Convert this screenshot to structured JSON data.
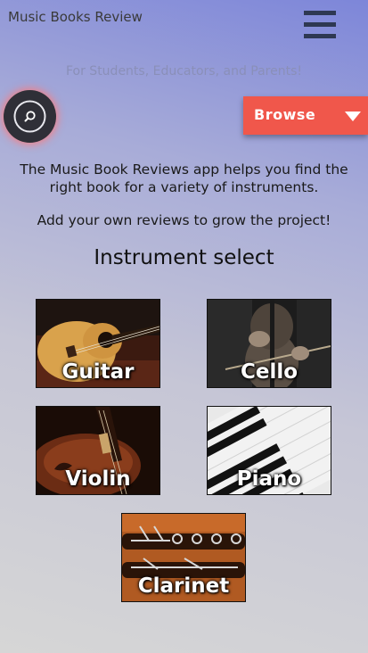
{
  "header": {
    "title": "Music Books Review",
    "tagline": "For Students, Educators, and Parents!"
  },
  "controls": {
    "browse_label": "Browse",
    "search_icon": "search-icon",
    "menu_icon": "hamburger-menu-icon"
  },
  "intro": {
    "paragraph1": "The Music Book Reviews app helps you find the right book for a variety of instruments.",
    "paragraph2": "Add your own reviews to grow the project!"
  },
  "instruments": {
    "heading": "Instrument select",
    "items": [
      {
        "label": "Guitar"
      },
      {
        "label": "Cello"
      },
      {
        "label": "Violin"
      },
      {
        "label": "Piano"
      },
      {
        "label": "Clarinet"
      }
    ]
  },
  "colors": {
    "accent": "#f0574b",
    "dark": "#2e3852",
    "background_top": "#7d86d9",
    "background_bottom": "#d6d6d6"
  }
}
